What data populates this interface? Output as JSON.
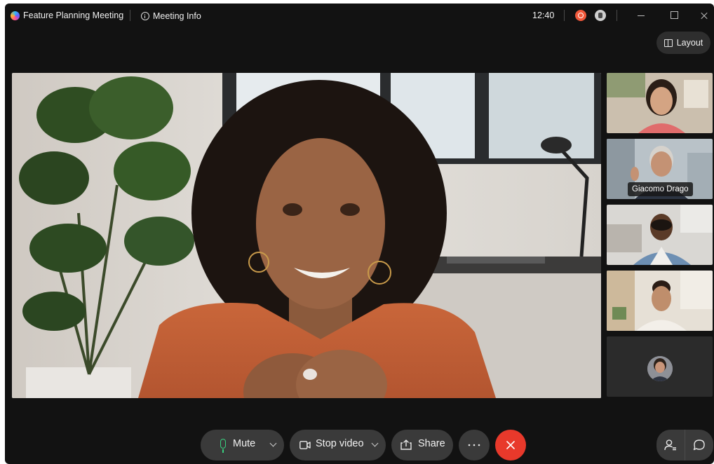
{
  "titlebar": {
    "meeting_title": "Feature Planning Meeting",
    "info_label": "Meeting Info",
    "clock": "12:40",
    "layout_label": "Layout"
  },
  "icons": {
    "app": "app-logo-icon",
    "info": "info-icon",
    "recording": "recording-icon",
    "encryption": "key-icon",
    "minimize": "minimize-icon",
    "maximize": "maximize-icon",
    "close": "close-icon",
    "layout": "layout-icon",
    "mic": "microphone-icon",
    "camera": "camera-icon",
    "share": "share-icon",
    "more": "more-icon",
    "end": "end-call-icon",
    "participants": "participants-icon",
    "chat": "chat-icon"
  },
  "participants": [
    {
      "name": "",
      "state": "video"
    },
    {
      "name": "Giacomo Drago",
      "state": "video"
    },
    {
      "name": "",
      "state": "video"
    },
    {
      "name": "",
      "state": "video"
    },
    {
      "name": "",
      "state": "avatar"
    }
  ],
  "controls": {
    "mute_label": "Mute",
    "stop_video_label": "Stop video",
    "share_label": "Share"
  },
  "colors": {
    "mic_active": "#39d07f",
    "end_call": "#e8392b",
    "recording": "#f0583a"
  }
}
